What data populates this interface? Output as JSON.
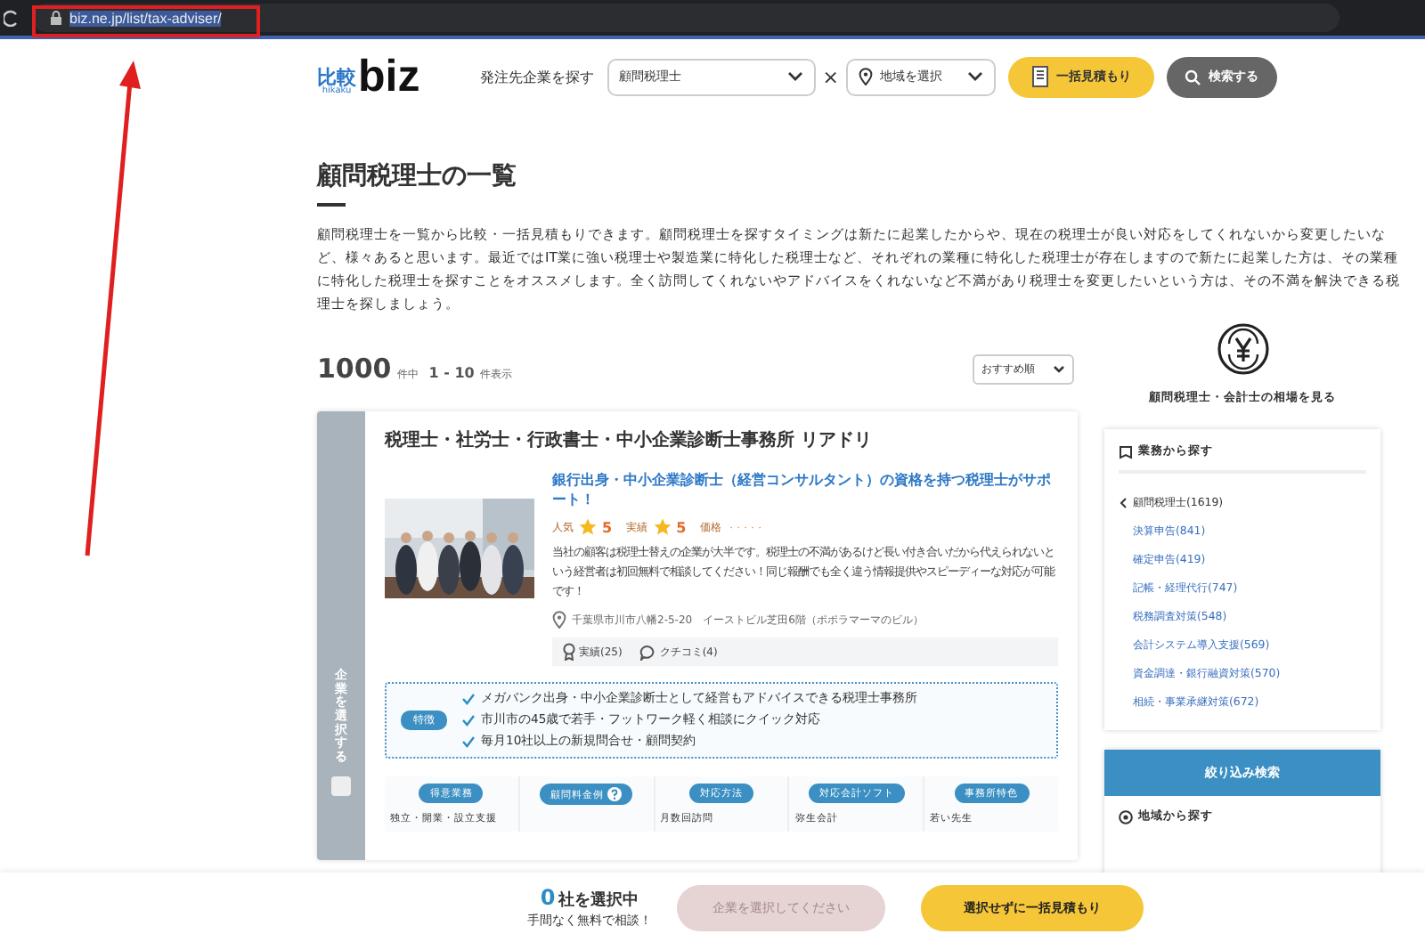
{
  "browser": {
    "url": "biz.ne.jp/list/tax-adviser/"
  },
  "annotation": {
    "kind": "box-arrow",
    "color": "#e02020"
  },
  "header": {
    "logo_kanji": "比較",
    "logo_kana": "hikaku",
    "logo_word": "biz",
    "search_label": "発注先企業を探す",
    "service_select": "顧問税理士",
    "separator": "×",
    "area_select": "地域を選択",
    "quote_button": "一括見積もり",
    "search_button": "検索する"
  },
  "page": {
    "title": "顧問税理士の一覧",
    "intro": "顧問税理士を一覧から比較・一括見積もりできます。顧問税理士を探すタイミングは新たに起業したからや、現在の税理士が良い対応をしてくれないから変更したいなど、様々あると思います。最近ではIT業に強い税理士や製造業に特化した税理士など、それぞれの業種に特化した税理士が存在しますので新たに起業した方は、その業種に特化した税理士を探すことをオススメします。全く訪問してくれないやアドバイスをくれないなど不満があり税理士を変更したいという方は、その不満を解決できる税理士を探しましょう。"
  },
  "results": {
    "total": "1000",
    "total_unit": "件中",
    "range": "1 - 10",
    "range_unit": "件表示",
    "sort": "おすすめ順"
  },
  "cards": [
    {
      "select_label": "企業を選択する",
      "checked": false,
      "name": "税理士・社労士・行政書士・中小企業診断士事務所 リアドリ",
      "catch": "銀行出身・中小企業診断士（経営コンサルタント）の資格を持つ税理士がサポート！",
      "ratings": [
        {
          "label": "人気",
          "kind": "star",
          "value": "5"
        },
        {
          "label": "実績",
          "kind": "star",
          "value": "5"
        },
        {
          "label": "価格",
          "kind": "dots",
          "value": "・・・・・"
        }
      ],
      "description": "当社の顧客は税理士替えの企業が大半です。税理士の不満があるけど長い付き合いだから代えられないという経営者は初回無料で相談してください！同じ報酬でも全く違う情報提供やスピーディーな対応が可能です！",
      "address": "千葉県市川市八幡2-5-20　イーストビル芝田6階（ポポラマーマのビル）",
      "counts": [
        {
          "kind": "award",
          "label": "実績(25)"
        },
        {
          "kind": "comment",
          "label": "クチコミ(4)"
        }
      ],
      "feature_tag": "特徴",
      "features": [
        "メガバンク出身・中小企業診断士として経営もアドバイスできる税理士事務所",
        "市川市の45歳で若手・フットワーク軽く相談にクイック対応",
        "毎月10社以上の新規問合せ・顧問契約"
      ],
      "details": [
        {
          "heading": "得意業務",
          "help": false,
          "value": "独立・開業・設立支援"
        },
        {
          "heading": "顧問料金例",
          "help": true
        },
        {
          "heading": "対応方法",
          "help": false,
          "value": "月数回訪問"
        },
        {
          "heading": "対応会計ソフト",
          "help": false,
          "value": "弥生会計"
        },
        {
          "heading": "事務所特色",
          "help": false,
          "value": "若い先生"
        }
      ]
    }
  ],
  "sidebar": {
    "price_link": "顧問税理士・会計士の相場を見る",
    "category_title": "業務から探す",
    "tree": [
      {
        "label": "顧問税理士(1619)",
        "expanded": true,
        "children": [
          {
            "label": "決算申告(841)"
          },
          {
            "label": "確定申告(419)"
          },
          {
            "label": "記帳・経理代行(747)"
          },
          {
            "label": "税務調査対策(548)"
          },
          {
            "label": "会計システム導入支援(569)"
          },
          {
            "label": "資金調達・銀行融資対策(570)"
          },
          {
            "label": "相続・事業承継対策(672)"
          }
        ]
      }
    ],
    "filter_title": "絞り込み検索",
    "area_title": "地域から探す"
  },
  "footer_bar": {
    "count": "0",
    "count_unit": "社を選択中",
    "note": "手間なく無料で相談！",
    "select_button": {
      "label": "企業を選択してください",
      "disabled": true
    },
    "bulk_button": "選択せずに一括見積もり"
  }
}
